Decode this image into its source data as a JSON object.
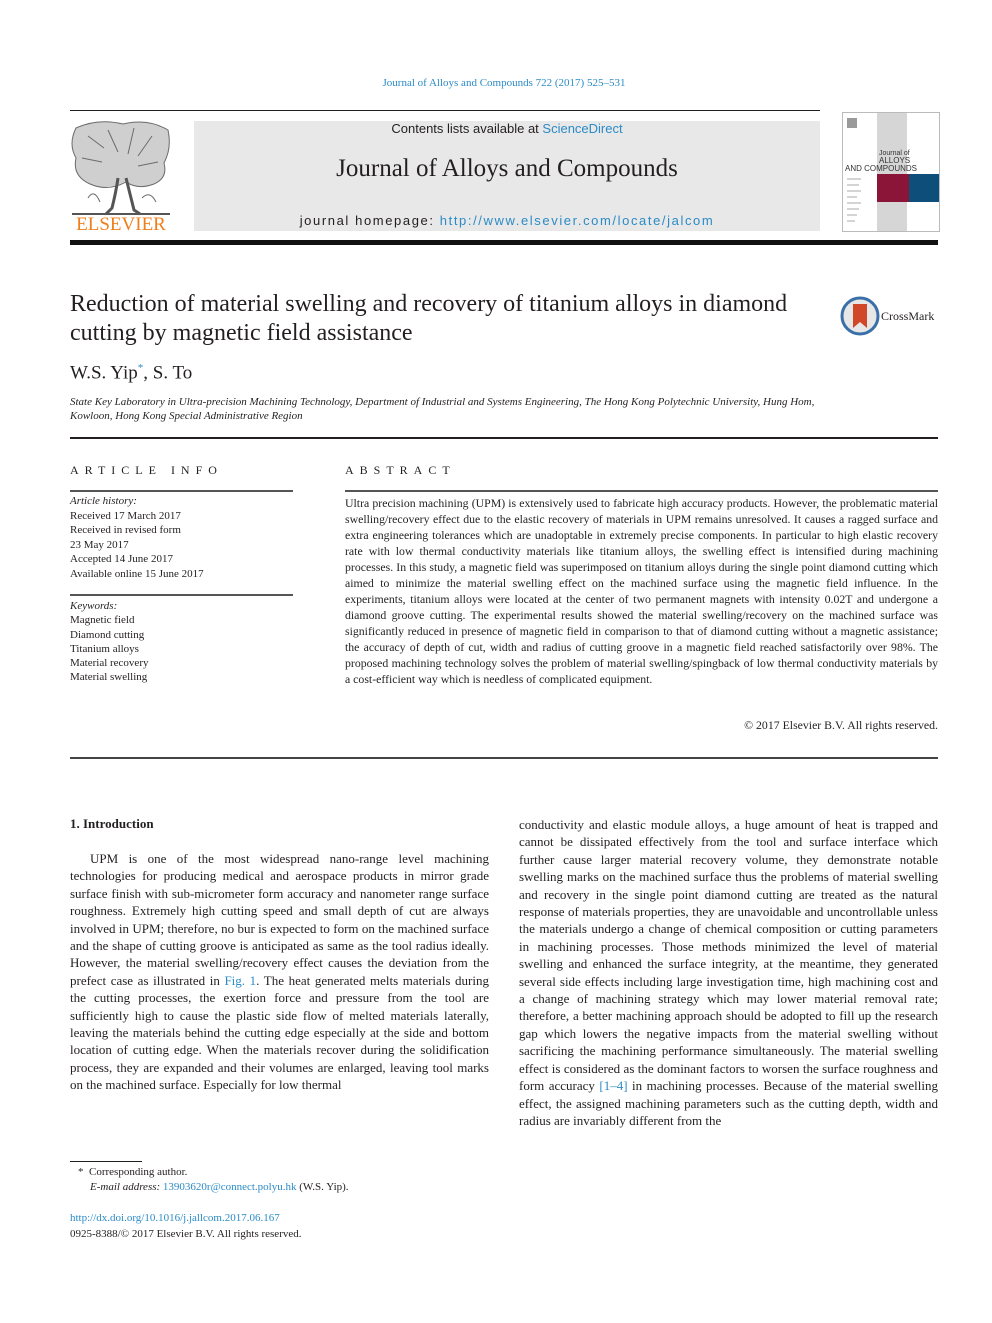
{
  "header": {
    "journal_ref": "Journal of Alloys and Compounds 722 (2017) 525–531",
    "contents_prefix": "Contents lists available at ",
    "contents_link": "ScienceDirect",
    "journal_name": "Journal of Alloys and Compounds",
    "homepage_prefix": "journal homepage: ",
    "homepage_url": "http://www.elsevier.com/locate/jalcom",
    "publisher_logo_text": "ELSEVIER",
    "cover": {
      "line1": "Journal of",
      "line2": "ALLOYS",
      "line3": "AND COMPOUNDS",
      "color_left": "#8b1538",
      "color_right": "#0d4f7a"
    },
    "colors": {
      "link": "#2b8bc6",
      "elsevier_orange": "#f07f1b"
    }
  },
  "article": {
    "title": "Reduction of material swelling and recovery of titanium alloys in diamond cutting by magnetic field assistance",
    "crossmark_label": "CrossMark",
    "authors": [
      {
        "name": "W.S. Yip",
        "marker": "*"
      },
      {
        "name": "S. To",
        "marker": ""
      }
    ],
    "author_separator": ", ",
    "affiliation": "State Key Laboratory in Ultra-precision Machining Technology, Department of Industrial and Systems Engineering, The Hong Kong Polytechnic University, Hung Hom, Kowloon, Hong Kong Special Administrative Region"
  },
  "article_info": {
    "heading": "ARTICLE INFO",
    "history_label": "Article history:",
    "history": [
      "Received 17 March 2017",
      "Received in revised form",
      "23 May 2017",
      "Accepted 14 June 2017",
      "Available online 15 June 2017"
    ],
    "keywords_label": "Keywords:",
    "keywords": [
      "Magnetic field",
      "Diamond cutting",
      "Titanium alloys",
      "Material recovery",
      "Material swelling"
    ]
  },
  "abstract": {
    "heading": "ABSTRACT",
    "text": "Ultra precision machining (UPM) is extensively used to fabricate high accuracy products. However, the problematic material swelling/recovery effect due to the elastic recovery of materials in UPM remains unresolved. It causes a ragged surface and extra engineering tolerances which are unadoptable in extremely precise components. In particular to high elastic recovery rate with low thermal conductivity materials like titanium alloys, the swelling effect is intensified during machining processes. In this study, a magnetic field was superimposed on titanium alloys during the single point diamond cutting which aimed to minimize the material swelling effect on the machined surface using the magnetic field influence. In the experiments, titanium alloys were located at the center of two permanent magnets with intensity 0.02T and undergone a diamond groove cutting. The experimental results showed the material swelling/recovery on the machined surface was significantly reduced in presence of magnetic field in comparison to that of diamond cutting without a magnetic assistance; the accuracy of depth of cut, width and radius of cutting groove in a magnetic field reached satisfactorily over 98%. The proposed machining technology solves the problem of material swelling/spingback of low thermal conductivity materials by a cost-efficient way which is needless of complicated equipment.",
    "copyright": "© 2017 Elsevier B.V. All rights reserved."
  },
  "introduction": {
    "heading": "1.  Introduction",
    "left_part1": "UPM is one of the most widespread nano-range level machining technologies for producing medical and aerospace products in mirror grade surface finish with sub-micrometer form accuracy and nanometer range surface roughness. Extremely high cutting speed and small depth of cut are always involved in UPM; therefore, no bur is expected to form on the machined surface and the shape of cutting groove is anticipated as same as the tool radius ideally. However, the material swelling/recovery effect causes the deviation from the prefect case as illustrated in ",
    "left_link": "Fig. 1",
    "left_part2": ". The heat generated melts materials during the cutting processes, the exertion force and pressure from the tool are sufficiently high to cause the plastic side flow of melted materials laterally, leaving the materials behind the cutting edge especially at the side and bottom location of cutting edge. When the materials recover during the solidification process, they are expanded and their volumes are enlarged, leaving tool marks on the machined surface. Especially for low thermal",
    "right_part1": "conductivity and elastic module alloys, a huge amount of heat is trapped and cannot be dissipated effectively from the tool and surface interface which further cause larger material recovery volume, they demonstrate notable swelling marks on the machined surface thus the problems of material swelling and recovery in the single point diamond cutting are treated as the natural response of materials properties, they are unavoidable and uncontrollable unless the materials undergo a change of chemical composition or cutting parameters in machining processes. Those methods minimized the level of material swelling and enhanced the surface integrity, at the meantime, they generated several side effects including large investigation time, high machining cost and a change of machining strategy which may lower material removal rate; therefore, a better machining approach should be adopted to fill up the research gap which lowers the negative impacts from the material swelling without sacrificing the machining performance simultaneously. The material swelling effect is considered as the dominant factors to worsen the surface roughness and form accuracy ",
    "right_link": "[1–4]",
    "right_part2": " in machining processes. Because of the material swelling effect, the assigned machining parameters such as the cutting depth, width and radius are invariably different from the"
  },
  "footnote": {
    "marker": "*",
    "corresponding": "Corresponding author.",
    "email_label": "E-mail address: ",
    "email": "13903620r@connect.polyu.hk",
    "email_suffix": " (W.S. Yip).",
    "doi": "http://dx.doi.org/10.1016/j.jallcom.2017.06.167",
    "issn_copyright": "0925-8388/© 2017 Elsevier B.V. All rights reserved."
  }
}
